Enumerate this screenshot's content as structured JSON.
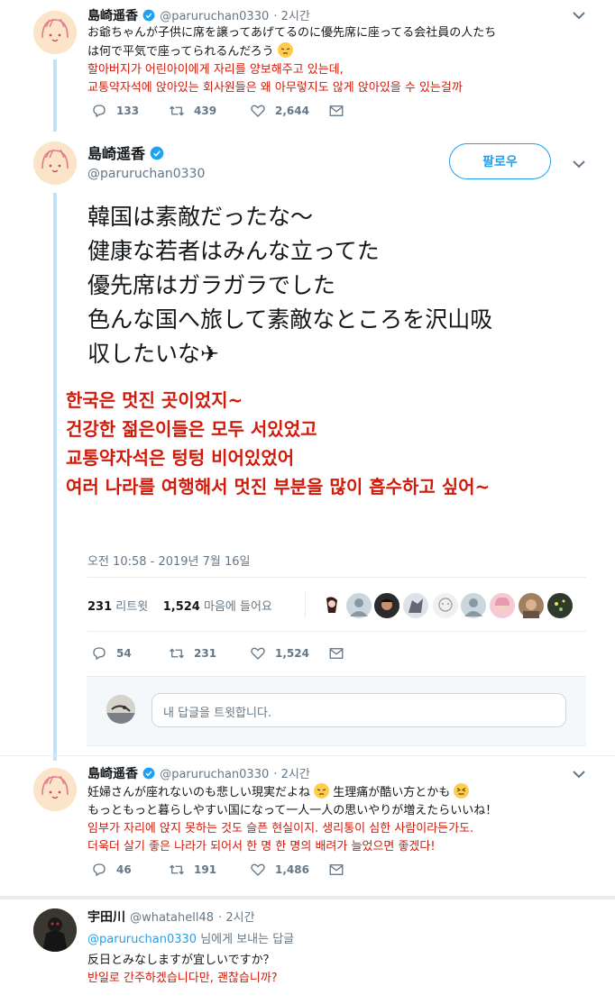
{
  "tweet1": {
    "name": "島崎遥香",
    "handle": "@paruruchan0330",
    "time": "· 2시간",
    "jp_line1": "お爺ちゃんが子供に席を譲ってあげてるのに優先席に座ってる会社員の人たち",
    "jp_line2": "は何で平気で座ってられるんだろう",
    "kr_line1": "할아버지가 어린아이에게 자리를 양보해주고 있는데,",
    "kr_line2": "교통약자석에 앉아있는 회사원들은 왜 아무렇지도 않게 앉아있을 수 있는걸까",
    "replies": "133",
    "retweets": "439",
    "likes": "2,644"
  },
  "main": {
    "name": "島崎遥香",
    "handle": "@paruruchan0330",
    "follow_label": "팔로우",
    "jp_lines": [
      "韓国は素敵だったな～",
      "健康な若者はみんな立ってた",
      "優先席はガラガラでした",
      "色んな国へ旅して素敵なところを沢山吸",
      "収したいな✈"
    ],
    "kr_lines": [
      "한국은 멋진 곳이었지~",
      "건강한 젊은이들은 모두 서있었고",
      "교통약자석은 텅텅 비어있었어",
      "여러 나라를 여행해서 멋진 부분을 많이 흡수하고 싶어~"
    ],
    "timestamp": "오전 10:58 - 2019년 7월 16일",
    "retweet_count": "231",
    "retweet_label": "리트윗",
    "like_count": "1,524",
    "like_label": "마음에 들어요",
    "replies": "54",
    "retweets": "231",
    "likes": "1,524",
    "reply_placeholder": "내 답글을 트윗합니다."
  },
  "tweet3": {
    "name": "島崎遥香",
    "handle": "@paruruchan0330",
    "time": "· 2시간",
    "jp_line1a": "妊婦さんが座れないのも悲しい現実だよね",
    "jp_line1b": "生理痛が酷い方とかも",
    "jp_line2": "もっともっと暮らしやすい国になって一人一人の思いやりが増えたらいいね！",
    "kr_line1": "임부가 자리에 앉지 못하는 것도 슬픈 현실이지. 생리통이 심한 사람이라든가도.",
    "kr_line2": "더욱더 살기 좋은 나라가 되어서 한 명 한 명의 배려가 늘었으면 좋겠다!",
    "replies": "46",
    "retweets": "191",
    "likes": "1,486"
  },
  "tweet4": {
    "name": "宇田川",
    "handle": "@whatahell48",
    "time": "· 2시간",
    "reply_to_handle": "@paruruchan0330",
    "reply_to_suffix": " 님에게 보내는 답글",
    "jp_line": "反日とみなしますが宜しいですか？",
    "kr_line": "반일로 간주하겠습니다만, 괜찮습니까?"
  },
  "colors": {
    "accent": "#1da1f2",
    "red_translation": "#d21a0a",
    "thread_line": "#c4e2f7",
    "secondary_text": "#657786"
  },
  "icons": [
    "verified-icon",
    "chevron-down-icon",
    "reply-icon",
    "retweet-icon",
    "heart-icon",
    "dm-icon",
    "plane-icon",
    "emoji-pensive-icon",
    "emoji-confounded-icon"
  ]
}
